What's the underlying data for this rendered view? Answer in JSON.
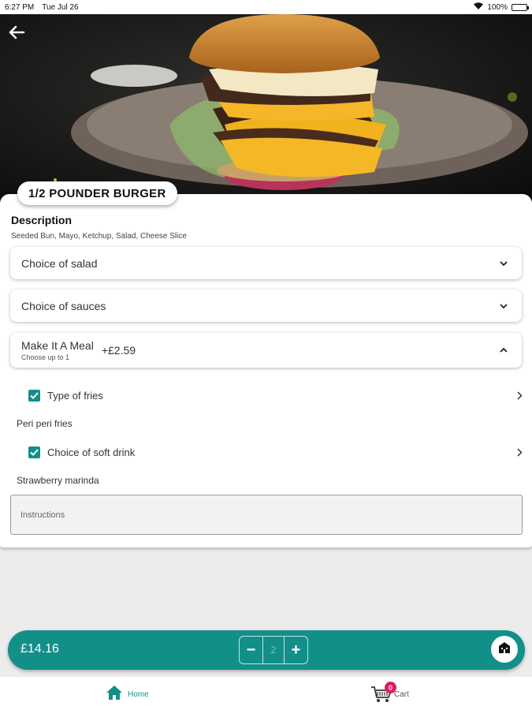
{
  "status_bar": {
    "time": "6:27 PM",
    "date": "Tue Jul 26",
    "battery": "100%"
  },
  "product": {
    "name": "1/2 POUNDER BURGER",
    "description_title": "Description",
    "description": "Seeded Bun, Mayo, Ketchup, Salad, Cheese Slice"
  },
  "options": {
    "salad": "Choice of salad",
    "sauces": "Choice of sauces",
    "meal": {
      "label": "Make It A Meal",
      "sub": "Choose up to 1",
      "price": "+£2.59"
    }
  },
  "meal_items": [
    {
      "label": "Type of fries",
      "selected": "Peri peri fries",
      "checked": true
    },
    {
      "label": "Choice of soft drink",
      "selected": "Strawberry marinda",
      "checked": true
    }
  ],
  "instructions": {
    "placeholder": "Instructions"
  },
  "cart_bar": {
    "price": "£14.16",
    "quantity": "2",
    "minus": "−",
    "plus": "+"
  },
  "nav": {
    "home": "Home",
    "cart": "Cart",
    "cart_count": "0"
  },
  "colors": {
    "accent": "#138f8a",
    "badge": "#e8175d"
  }
}
